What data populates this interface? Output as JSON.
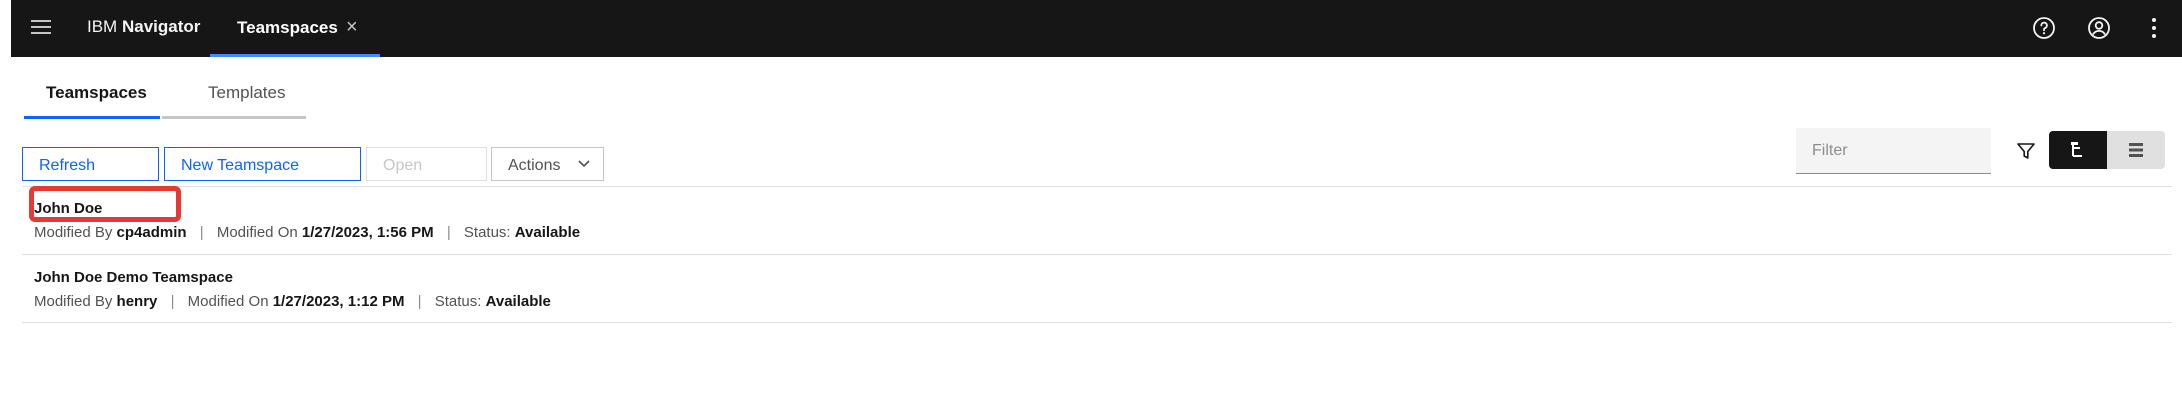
{
  "header": {
    "brand_prefix": "IBM",
    "brand_name": "Navigator",
    "active_tab": "Teamspaces",
    "close_symbol": "×"
  },
  "subtabs": [
    "Teamspaces",
    "Templates"
  ],
  "toolbar": {
    "refresh": "Refresh",
    "new_teamspace": "New Teamspace",
    "open": "Open",
    "actions": "Actions"
  },
  "filter": {
    "placeholder": "Filter"
  },
  "rows": [
    {
      "name": "John Doe",
      "modified_by_label": "Modified By",
      "modified_by": "cp4admin",
      "modified_on_label": "Modified On",
      "modified_on": "1/27/2023, 1:56 PM",
      "status_label": "Status:",
      "status": "Available",
      "highlighted": true
    },
    {
      "name": "John Doe Demo Teamspace",
      "modified_by_label": "Modified By",
      "modified_by": "henry",
      "modified_on_label": "Modified On",
      "modified_on": "1/27/2023, 1:12 PM",
      "status_label": "Status:",
      "status": "Available",
      "highlighted": false
    }
  ],
  "colors": {
    "header_bg": "#161616",
    "accent_blue": "#0f62fe",
    "tab_underline": "#4589ff",
    "highlight_red": "#e53935"
  },
  "icons": [
    "hamburger-menu-icon",
    "help-icon",
    "user-avatar-icon",
    "overflow-menu-icon",
    "close-icon",
    "chevron-down-icon",
    "filter-icon",
    "tree-view-icon",
    "list-view-icon"
  ]
}
